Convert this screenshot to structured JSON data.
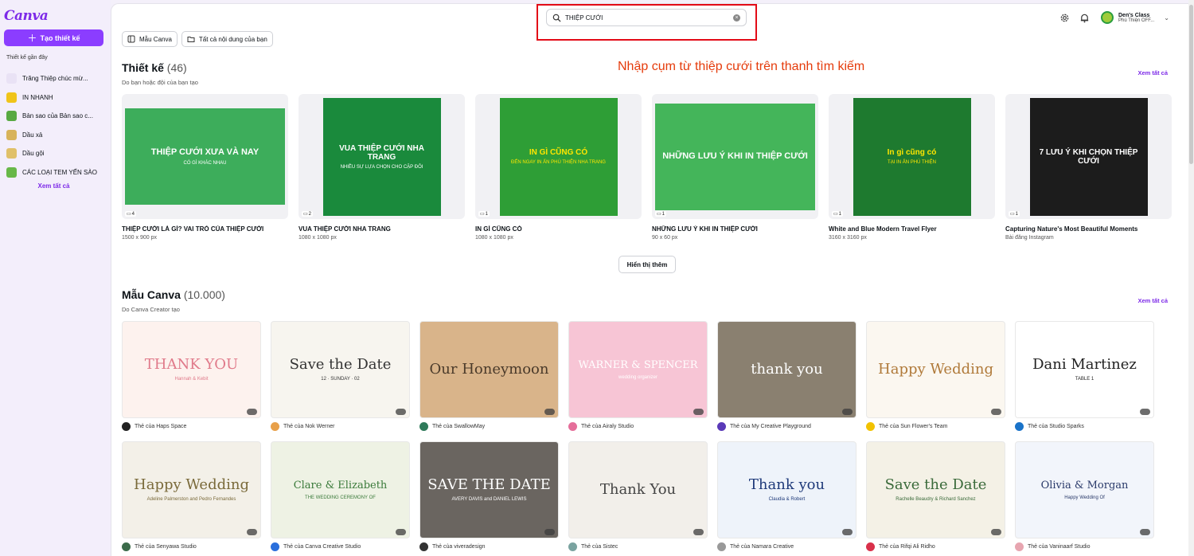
{
  "sidebar": {
    "logo": "Canva",
    "create_label": "Tạo thiết kế",
    "recent_title": "Thiết kế gần đây",
    "recent": [
      {
        "label": "Trăng Thiệp chúc mừ...",
        "color": "#e9e2f5"
      },
      {
        "label": "IN NHANH",
        "color": "#f0c419"
      },
      {
        "label": "Bản sao của Bản sao c...",
        "color": "#58a942"
      },
      {
        "label": "Dầu xả",
        "color": "#d8b35a"
      },
      {
        "label": "Dầu gội",
        "color": "#e0c069"
      },
      {
        "label": "CÁC LOẠI TEM YẾN SÀO",
        "color": "#68b848"
      }
    ],
    "see_all": "Xem tất cả"
  },
  "search": {
    "value": "THIỆP CƯỚI"
  },
  "account": {
    "name": "Den's Class",
    "sub": "Phú Thiện OFF..."
  },
  "filters": {
    "templates": "Mẫu Canva",
    "all_content": "Tất cả nội dung của bạn"
  },
  "annotation": "Nhập cụm từ thiệp cưới trên thanh tìm kiếm",
  "designs": {
    "title": "Thiết kế",
    "count": "(46)",
    "subtitle": "Do bạn hoặc đội của bạn tạo",
    "see_all": "Xem tất cả",
    "items": [
      {
        "title": "THIỆP CƯỚI LÀ GÌ? VAI TRÒ CỦA THIỆP CƯỚI",
        "meta": "1500 x 900 px",
        "pages": "4",
        "thumb_text": "THIỆP CƯỚI XƯA VÀ NAY",
        "thumb_sub": "CÓ GÌ KHÁC NHAU",
        "bg": "#3dad5b",
        "fg": "#ffffff"
      },
      {
        "title": "VUA THIỆP CƯỚI NHA TRANG",
        "meta": "1080 x 1080 px",
        "pages": "2",
        "thumb_text": "VUA THIỆP CƯỚI NHA TRANG",
        "thumb_sub": "NHIỀU SỰ LỰA CHỌN CHO CẶP ĐÔI",
        "bg": "#1a8a3c",
        "fg": "#ffffff"
      },
      {
        "title": "IN GÌ CŨNG CÓ",
        "meta": "1080 x 1080 px",
        "pages": "1",
        "thumb_text": "IN GÌ CŨNG CÓ",
        "thumb_sub": "ĐẾN NGAY IN ẤN PHÚ THIỆN NHA TRANG",
        "bg": "#2e9e36",
        "fg": "#ffe600"
      },
      {
        "title": "NHỮNG LƯU Ý KHI IN THIỆP CƯỚI",
        "meta": "90 x 60 px",
        "pages": "1",
        "thumb_text": "NHỮNG LƯU Ý KHI IN THIỆP CƯỚI",
        "thumb_sub": "",
        "bg": "#44b55a",
        "fg": "#ffffff"
      },
      {
        "title": "White and Blue Modern Travel Flyer",
        "meta": "3160 x 3160 px",
        "pages": "1",
        "thumb_text": "In gì cũng có",
        "thumb_sub": "TẠI IN ẤN PHÚ THIỆN",
        "bg": "#1e7a2f",
        "fg": "#ffe600"
      },
      {
        "title": "Capturing Nature's Most Beautiful Moments",
        "meta": "Bài đăng Instagram",
        "pages": "1",
        "thumb_text": "7 LƯU Ý KHI CHỌN THIỆP CƯỚI",
        "thumb_sub": "",
        "bg": "#1c1c1c",
        "fg": "#ffffff"
      }
    ]
  },
  "show_more": "Hiển thị thêm",
  "templates": {
    "title": "Mẫu Canva",
    "count": "(10.000)",
    "subtitle": "Do Canva Creator tạo",
    "see_all": "Xem tất cả",
    "row1": [
      {
        "author": "Thẻ của Haps Space",
        "text": "THANK YOU",
        "sub": "Hannah & Kebit",
        "bg": "#fdf2ee",
        "fg": "#e07a8a",
        "av": "#222222"
      },
      {
        "author": "Thẻ của Nok Werner",
        "text": "Save the Date",
        "sub": "12 · SUNDAY · 02",
        "bg": "#f7f5ef",
        "fg": "#333333",
        "av": "#e8a04a"
      },
      {
        "author": "Thẻ của SwallowMay",
        "text": "Our Honeymoon",
        "sub": "",
        "bg": "#d9b48a",
        "fg": "#4a3a2a",
        "av": "#2f7a5a"
      },
      {
        "author": "Thẻ của Airaly Studio",
        "text": "WARNER & SPENCER",
        "sub": "wedding organizer",
        "bg": "#f7c5d5",
        "fg": "#ffffff",
        "av": "#e56e9a"
      },
      {
        "author": "Thẻ của My Creative Playground",
        "text": "thank you",
        "sub": "",
        "bg": "#8a8070",
        "fg": "#ffffff",
        "av": "#5a3ab8"
      },
      {
        "author": "Thẻ của Sun Flower's Team",
        "text": "Happy Wedding",
        "sub": "",
        "bg": "#fbf7f0",
        "fg": "#b07a3a",
        "av": "#f2c200"
      },
      {
        "author": "Thẻ của Studio Sparks",
        "text": "Dani Martinez",
        "sub": "TABLE 1",
        "bg": "#ffffff",
        "fg": "#222222",
        "av": "#1a73c9"
      }
    ],
    "row2": [
      {
        "author": "Thẻ của Senyawa Studio",
        "text": "Happy Wedding",
        "sub": "Adeline Palmerston and Pedro Fernandes",
        "bg": "#f3f0e8",
        "fg": "#7a6a3a",
        "av": "#3b6b4a"
      },
      {
        "author": "Thẻ của Canva Creative Studio",
        "text": "Clare & Elizabeth",
        "sub": "THE WEDDING CEREMONY OF",
        "bg": "#eef2e4",
        "fg": "#3a7a3a",
        "av": "#2a6fdc"
      },
      {
        "author": "Thẻ của viveradesign",
        "text": "SAVE THE DATE",
        "sub": "AVERY DAVIS and DANIEL LEWIS",
        "bg": "#6a6560",
        "fg": "#ffffff",
        "av": "#333333"
      },
      {
        "author": "Thẻ của Sistec",
        "text": "Thank You",
        "sub": "",
        "bg": "#f2efea",
        "fg": "#444444",
        "av": "#7aa3a0"
      },
      {
        "author": "Thẻ của Namara Creative",
        "text": "Thank you",
        "sub": "Claudia & Robert",
        "bg": "#eef3fa",
        "fg": "#1f3a7a",
        "av": "#999999"
      },
      {
        "author": "Thẻ của Rifqi Ali Ridho",
        "text": "Save the Date",
        "sub": "Rachelle Beaudry & Richard Sanchez",
        "bg": "#f4f1e6",
        "fg": "#3a6a3a",
        "av": "#d9304a"
      },
      {
        "author": "Thẻ của Vaninaarf Studio",
        "text": "Olivia & Morgan",
        "sub": "Happy Wedding Of",
        "bg": "#f2f5fb",
        "fg": "#2a3a6a",
        "av": "#e7a5b0"
      }
    ]
  }
}
